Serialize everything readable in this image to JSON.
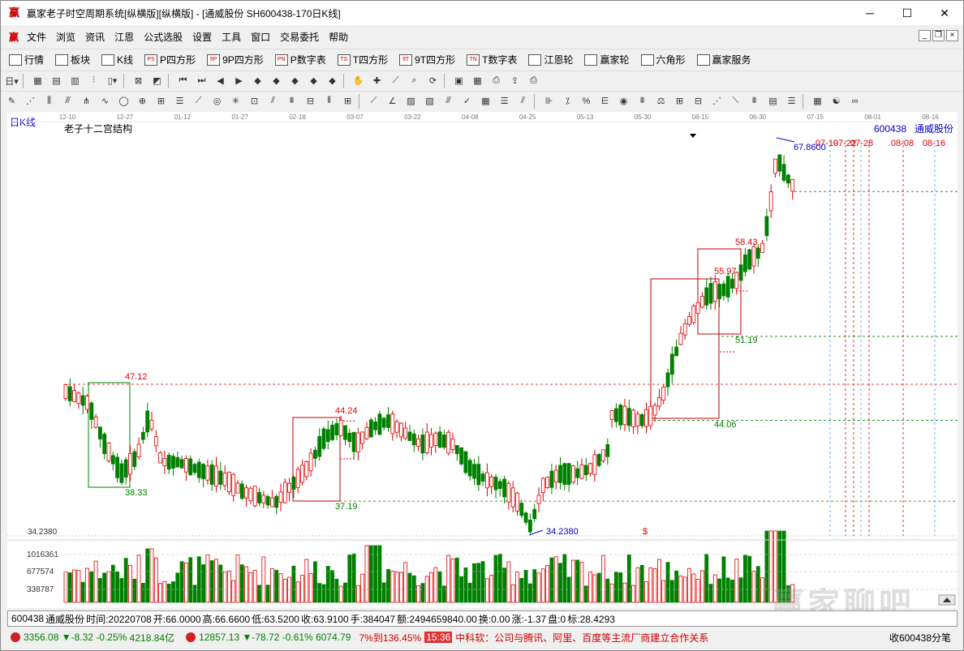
{
  "window": {
    "title": "赢家老子时空周期系统[纵横版][纵横版] - [通威股份   SH600438-170日K线]",
    "logo": "赢"
  },
  "menu": [
    "文件",
    "浏览",
    "资讯",
    "江恩",
    "公式选股",
    "设置",
    "工具",
    "窗口",
    "交易委托",
    "帮助"
  ],
  "toolbar1": [
    {
      "icon": "grid-icon",
      "label": "行情"
    },
    {
      "icon": "blocks-icon",
      "label": "板块"
    },
    {
      "icon": "kline-icon",
      "label": "K线"
    },
    {
      "icon": "ps-icon",
      "label": "P四方形",
      "badge": "PS"
    },
    {
      "icon": "9p-icon",
      "label": "9P四方形",
      "badge": "9P"
    },
    {
      "icon": "pn-icon",
      "label": "P数字表",
      "badge": "PN"
    },
    {
      "icon": "ts-icon",
      "label": "T四方形",
      "badge": "TS"
    },
    {
      "icon": "9t-icon",
      "label": "9T四方形",
      "badge": "9T"
    },
    {
      "icon": "tn-icon",
      "label": "T数字表",
      "badge": "TN"
    },
    {
      "icon": "gann-wheel-icon",
      "label": "江恩轮"
    },
    {
      "icon": "winner-wheel-icon",
      "label": "赢家轮"
    },
    {
      "icon": "hexagon-icon",
      "label": "六角形"
    },
    {
      "icon": "dollar-icon",
      "label": "赢家服务"
    }
  ],
  "chart": {
    "period_label": "日K线",
    "indicator_title": "老子十二宫结构",
    "stock_code": "600438",
    "stock_name": "通威股份",
    "date_ticks": [
      "12-10",
      "12-27",
      "01-12",
      "01-27",
      "02-18",
      "03-07",
      "03-22",
      "04-08",
      "04-25",
      "05-13",
      "05-30",
      "06-15",
      "06-30",
      "07-15",
      "08-01",
      "08-16"
    ],
    "future_dates": [
      "07-19",
      "07-22",
      "07-28",
      "08-08",
      "08-16"
    ],
    "price_labels": [
      "47.12",
      "38.33",
      "44.24",
      "37.19",
      "55.97",
      "58.43",
      "51.19",
      "44.06",
      "67.8600",
      "34.2380"
    ],
    "low_marker": "34.2380",
    "volume_ticks": [
      "1016361",
      "677574",
      "338787"
    ],
    "dollar_mark": "$"
  },
  "chart_data": {
    "type": "candlestick",
    "title": "老子十二宫结构",
    "ylim": [
      34.238,
      67.86
    ],
    "reference_levels": [
      47.12,
      44.24,
      44.06,
      51.19,
      55.97,
      58.43,
      38.33,
      37.19,
      34.238,
      67.86
    ],
    "high": 67.86,
    "low": 34.238
  },
  "status": {
    "code": "600438",
    "name": "通威股份",
    "time": "时间:20220708",
    "open": "开:66.0000",
    "high": "高:66.6600",
    "low": "低:63.5200",
    "close": "收:63.9100",
    "hand": "手:384047",
    "amount": "额:2494659840.00",
    "turnover": "换:0.00",
    "change": "涨:-1.37",
    "pan": "盘:0",
    "mark": "标:28.4293"
  },
  "indices": [
    {
      "value": "3356.08",
      "change": "▼-8.32 -0.25%",
      "amount": "4218.84亿"
    },
    {
      "value": "12857.13",
      "change": "▼-78.72 -0.61%",
      "amount": "6074.79"
    }
  ],
  "ticker": {
    "prefix": "7%到136.45%",
    "time": "15:36",
    "news": "中科软：公司与腾讯、阿里、百度等主流厂商建立合作关系",
    "right": "收600438分笔"
  },
  "watermark": "赢家聊吧"
}
